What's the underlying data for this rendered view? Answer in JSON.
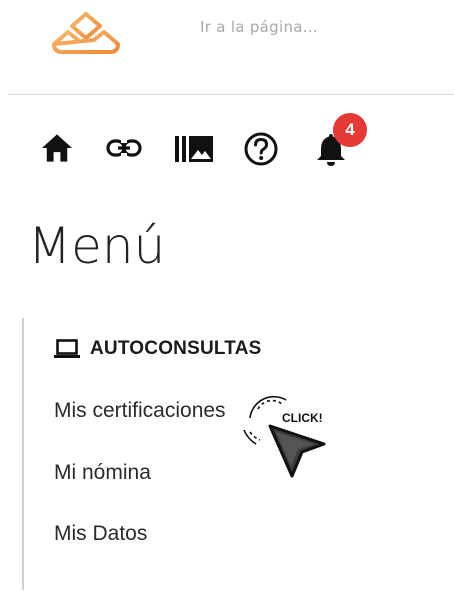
{
  "header": {
    "search_placeholder": "Ir a la página..."
  },
  "icons": {
    "notification_count": "4",
    "brand_color": "#f0a050",
    "badge_color": "#e53935"
  },
  "menu": {
    "title": "Menú",
    "section": {
      "label": "AUTOCONSULTAS",
      "icon": "laptop-icon",
      "items": [
        {
          "label": "Mis certificaciones"
        },
        {
          "label": "Mi nómina"
        },
        {
          "label": "Mis Datos"
        }
      ]
    }
  },
  "annotation": {
    "click_text": "CLICK!"
  }
}
